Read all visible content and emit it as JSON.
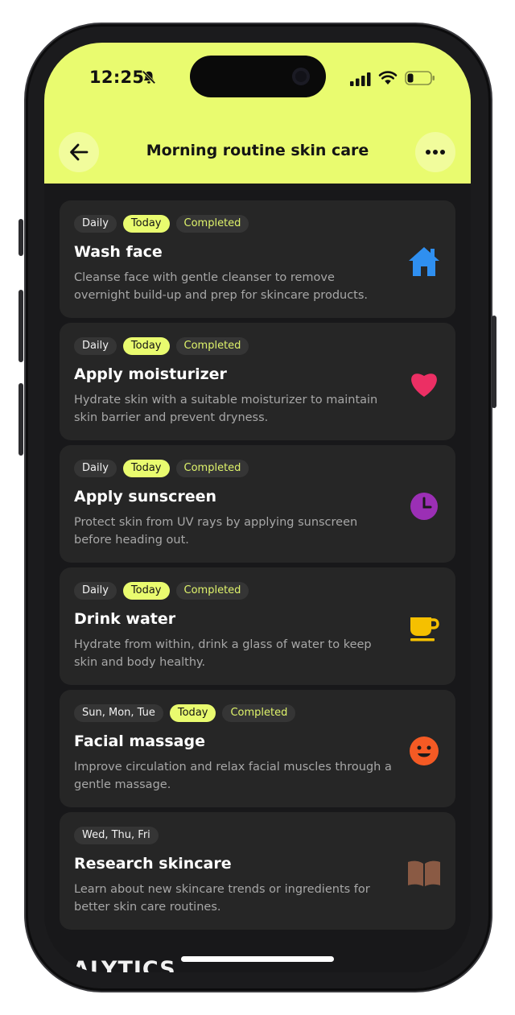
{
  "status": {
    "time": "12:25"
  },
  "header": {
    "title": "Morning routine skin care"
  },
  "icons": {
    "back": "arrow-left-icon",
    "more": "more-horizontal-icon"
  },
  "cards": [
    {
      "recurrence": "Daily",
      "today": "Today",
      "status": "Completed",
      "title": "Wash face",
      "description": "Cleanse face with gentle cleanser to remove overnight build-up and prep for skincare products.",
      "icon": "home-icon",
      "icon_color": "#2f8ff0"
    },
    {
      "recurrence": "Daily",
      "today": "Today",
      "status": "Completed",
      "title": "Apply moisturizer",
      "description": "Hydrate skin with a suitable moisturizer to maintain skin barrier and prevent dryness.",
      "icon": "heart-icon",
      "icon_color": "#ec2f64"
    },
    {
      "recurrence": "Daily",
      "today": "Today",
      "status": "Completed",
      "title": "Apply sunscreen",
      "description": "Protect skin from UV rays by applying sunscreen before heading out.",
      "icon": "clock-icon",
      "icon_color": "#9b2fb5"
    },
    {
      "recurrence": "Daily",
      "today": "Today",
      "status": "Completed",
      "title": "Drink water",
      "description": "Hydrate from within, drink a glass of water to keep skin and body healthy.",
      "icon": "coffee-cup-icon",
      "icon_color": "#f5c000"
    },
    {
      "recurrence": "Sun, Mon, Tue",
      "today": "Today",
      "status": "Completed",
      "title": "Facial massage",
      "description": "Improve circulation and relax facial muscles through a gentle massage.",
      "icon": "smiley-icon",
      "icon_color": "#f45a24"
    },
    {
      "recurrence": "Wed, Thu, Fri",
      "title": "Research skincare",
      "description": "Learn about new skincare trends or ingredients for better skin care routines.",
      "icon": "book-icon",
      "icon_color": "#8a5a44"
    }
  ],
  "section": {
    "analytics": "ALYTICS"
  },
  "colors": {
    "accent": "#e9fb6f",
    "background": "#18181a",
    "card": "#262626"
  }
}
